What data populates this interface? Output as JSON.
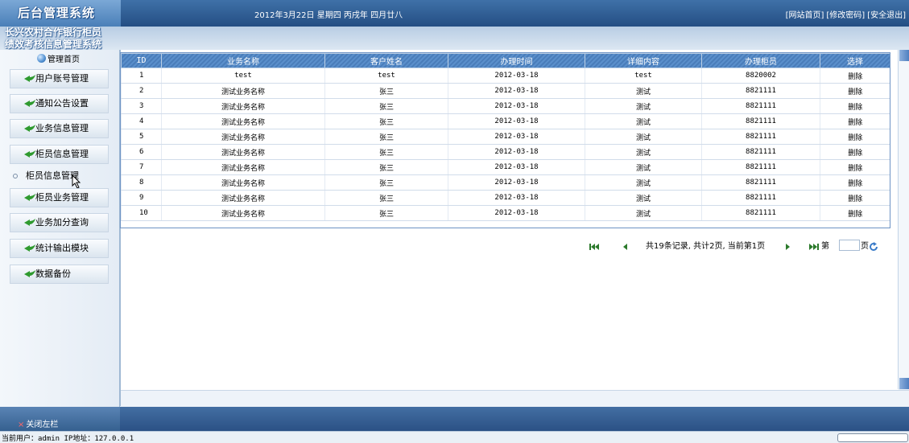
{
  "header": {
    "logo": "后台管理系统",
    "date": "2012年3月22日 星期四 丙戌年 四月廿八",
    "links": [
      "[网站首页]",
      "[修改密码]",
      "[安全退出]"
    ]
  },
  "system_title": [
    "长兴农村合作银行柜员",
    "绩效考核信息管理系统"
  ],
  "sidebar": {
    "home": "管理首页",
    "items": [
      {
        "label": "用户账号管理"
      },
      {
        "label": "通知公告设置"
      },
      {
        "label": "业务信息管理"
      },
      {
        "label": "柜员信息管理"
      },
      {
        "label": "柜员信息管理"
      },
      {
        "label": "柜员业务管理"
      },
      {
        "label": "业务加分查询"
      },
      {
        "label": "统计输出模块"
      },
      {
        "label": "数据备份"
      }
    ]
  },
  "table": {
    "columns": [
      "ID",
      "业务名称",
      "客户姓名",
      "办理时间",
      "详细内容",
      "办理柜员",
      "选择"
    ],
    "rows": [
      [
        "1",
        "test",
        "test",
        "2012-03-18",
        "test",
        "8820002",
        "删除"
      ],
      [
        "2",
        "测试业务名称",
        "张三",
        "2012-03-18",
        "测试",
        "8821111",
        "删除"
      ],
      [
        "3",
        "测试业务名称",
        "张三",
        "2012-03-18",
        "测试",
        "8821111",
        "删除"
      ],
      [
        "4",
        "测试业务名称",
        "张三",
        "2012-03-18",
        "测试",
        "8821111",
        "删除"
      ],
      [
        "5",
        "测试业务名称",
        "张三",
        "2012-03-18",
        "测试",
        "8821111",
        "删除"
      ],
      [
        "6",
        "测试业务名称",
        "张三",
        "2012-03-18",
        "测试",
        "8821111",
        "删除"
      ],
      [
        "7",
        "测试业务名称",
        "张三",
        "2012-03-18",
        "测试",
        "8821111",
        "删除"
      ],
      [
        "8",
        "测试业务名称",
        "张三",
        "2012-03-18",
        "测试",
        "8821111",
        "删除"
      ],
      [
        "9",
        "测试业务名称",
        "张三",
        "2012-03-18",
        "测试",
        "8821111",
        "删除"
      ],
      [
        "10",
        "测试业务名称",
        "张三",
        "2012-03-18",
        "测试",
        "8821111",
        "删除"
      ]
    ]
  },
  "pager": {
    "summary": "共19条记录, 共计2页, 当前第1页",
    "goto_prefix": "第",
    "goto_suffix": "页",
    "page_input_value": ""
  },
  "footer": {
    "close_sidebar": "关闭左栏",
    "status": "当前用户：admin  IP地址：127.0.0.1"
  },
  "colors": {
    "header_bg": "#2f5d94",
    "table_header": "#5a8fcb",
    "leaf_green": "#2f9a2f"
  }
}
